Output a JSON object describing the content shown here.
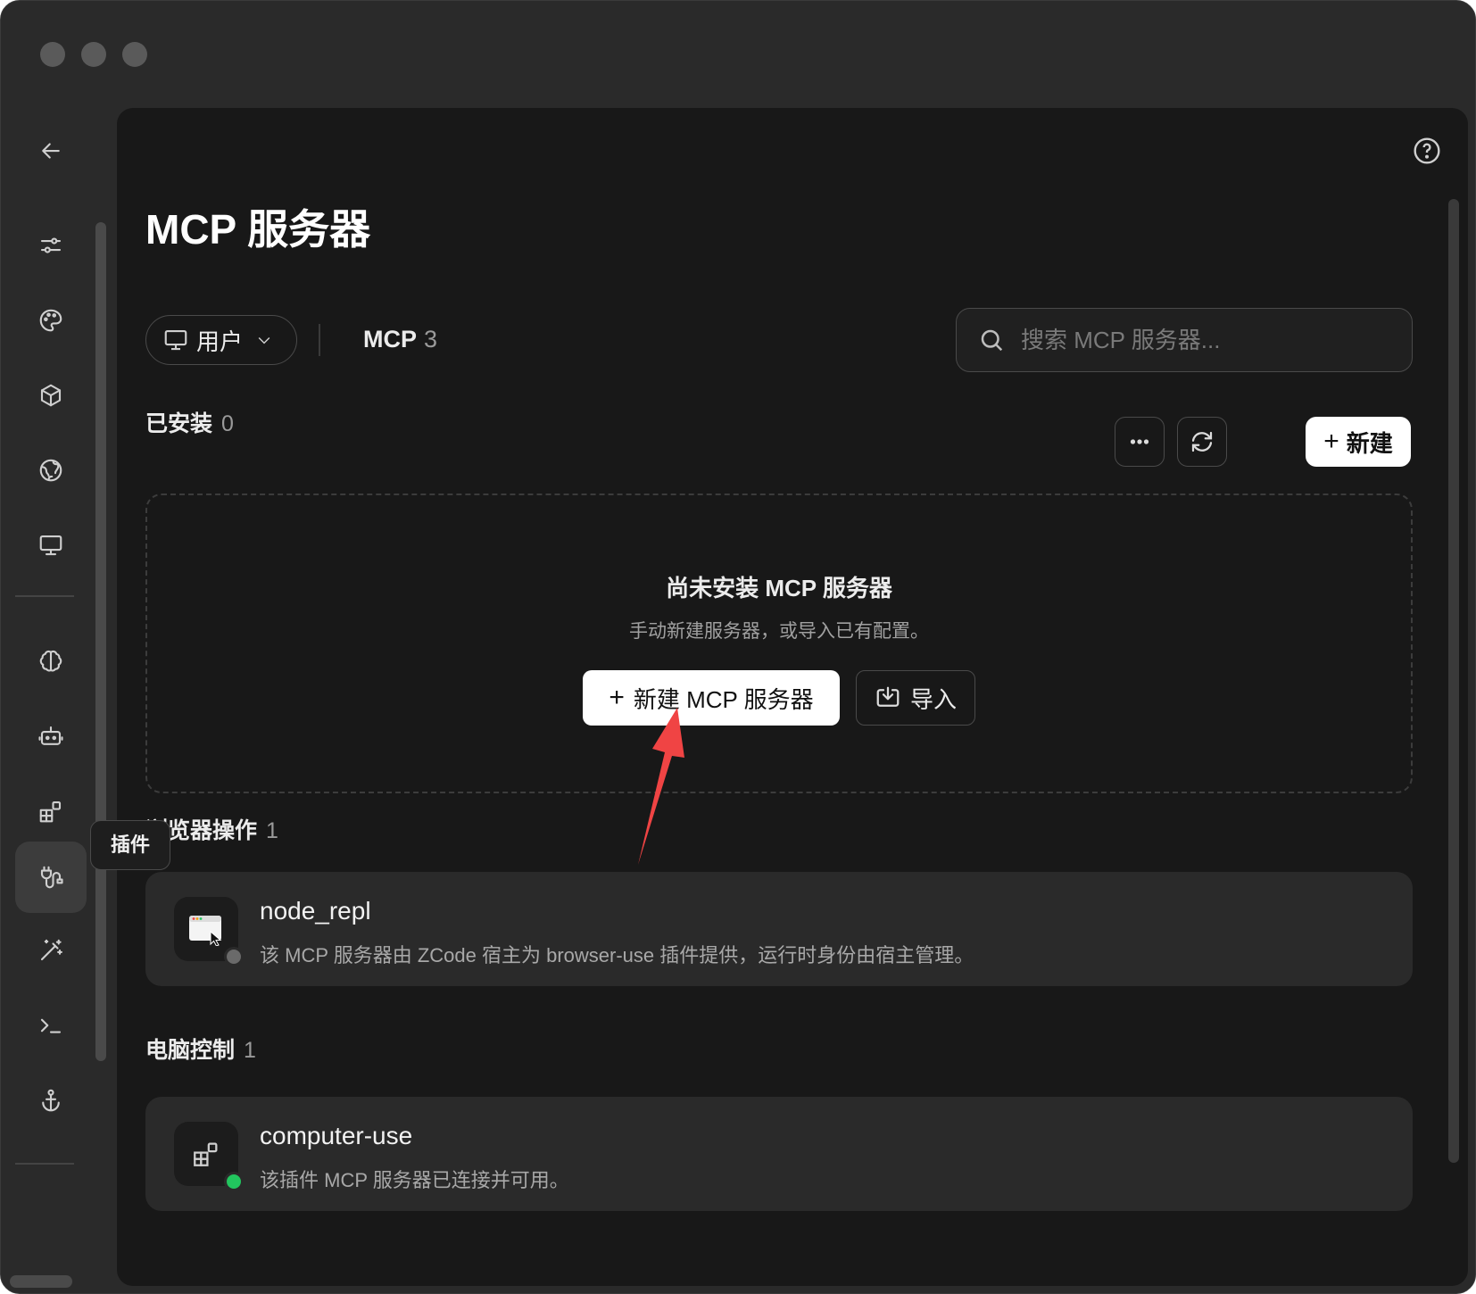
{
  "page": {
    "title": "MCP 服务器",
    "help_icon": "help-circle-icon"
  },
  "sidebar": {
    "items": [
      {
        "icon": "back-arrow-icon"
      },
      {
        "icon": "sliders-icon"
      },
      {
        "icon": "palette-icon"
      },
      {
        "icon": "package-icon"
      },
      {
        "icon": "globe-icon"
      },
      {
        "icon": "monitor-icon"
      },
      {
        "icon": "brain-icon"
      },
      {
        "icon": "bot-icon"
      },
      {
        "icon": "plugins-icon"
      },
      {
        "icon": "mcp-plug-icon",
        "active": true
      },
      {
        "icon": "magic-wand-icon"
      },
      {
        "icon": "terminal-icon"
      },
      {
        "icon": "anchor-icon"
      }
    ],
    "tooltip": "插件"
  },
  "toolbar": {
    "scope_label": "用户",
    "tab_label": "MCP",
    "tab_count": "3",
    "search_placeholder": "搜索 MCP 服务器..."
  },
  "installed": {
    "label": "已安装",
    "count": "0",
    "new_label": "新建",
    "empty_title": "尚未安装 MCP 服务器",
    "empty_subtitle": "手动新建服务器，或导入已有配置。",
    "new_mcp_label": "新建 MCP 服务器",
    "import_label": "导入"
  },
  "groups": [
    {
      "label": "浏览器操作",
      "count": "1",
      "server": {
        "name": "node_repl",
        "description": "该 MCP 服务器由 ZCode 宿主为 browser-use 插件提供，运行时身份由宿主管理。",
        "status_color": "#6a6a6a"
      }
    },
    {
      "label": "电脑控制",
      "count": "1",
      "server": {
        "name": "computer-use",
        "description": "该插件 MCP 服务器已连接并可用。",
        "status_color": "#22c55e"
      }
    }
  ],
  "colors": {
    "accent_arrow": "#f04444",
    "status_connected": "#22c55e"
  }
}
